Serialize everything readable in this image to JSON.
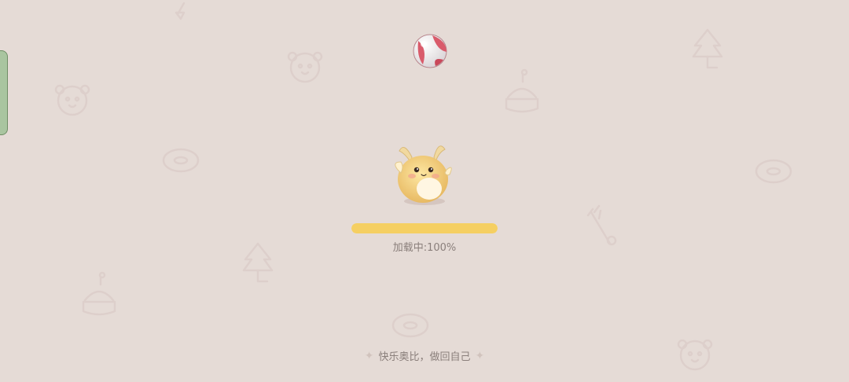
{
  "loading": {
    "label": "加载中:100%",
    "progress": 1.0
  },
  "slogan": {
    "text": "快乐奥比，做回自己",
    "left_sparkle": "✦",
    "right_sparkle": "✦"
  },
  "colors": {
    "background": "#e5dbd6",
    "progress_fill": "#f5cf62",
    "text": "#8a7f7b",
    "side_tab": "#a9c5a0"
  },
  "icons": {
    "ball": "beach-ball-icon",
    "mascot": "yellow-fluffy-pet-icon"
  }
}
